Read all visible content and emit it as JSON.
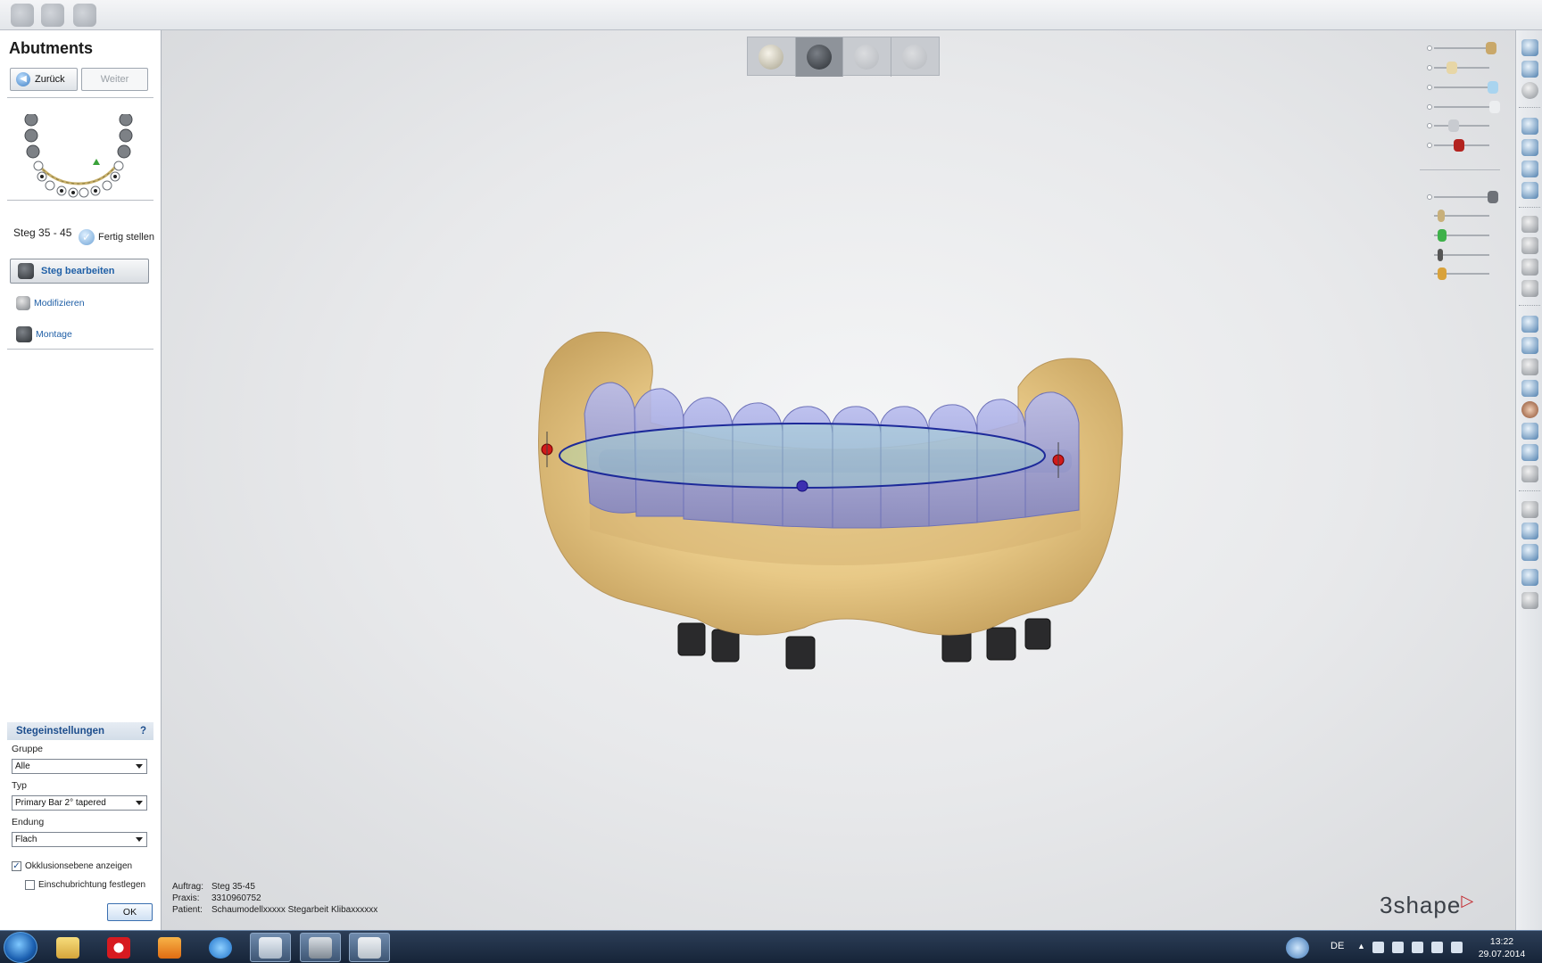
{
  "panel": {
    "title": "Abutments",
    "back_label": "Zurück",
    "next_label": "Weiter",
    "steg_label": "Steg 35 - 45",
    "finish_label": "Fertig stellen",
    "edit_label": "Steg bearbeiten",
    "modify_label": "Modifizieren",
    "mount_label": "Montage"
  },
  "settings": {
    "header": "Stegeinstellungen",
    "help": "?",
    "group_label": "Gruppe",
    "group_value": "Alle",
    "type_label": "Typ",
    "type_value": "Primary Bar 2° tapered",
    "ending_label": "Endung",
    "ending_value": "Flach",
    "occlusion_label": "Okklusionsebene anzeigen",
    "occlusion_checked": true,
    "insertion_label": "Einschubrichtung festlegen",
    "insertion_checked": false,
    "ok_label": "OK"
  },
  "info": {
    "order_key": "Auftrag:",
    "order_value": "Steg 35-45",
    "practice_key": "Praxis:",
    "practice_value": "3310960752",
    "patient_key": "Patient:",
    "patient_value": "Schaumodellxxxxx Stegarbeit Klibaxxxxxx"
  },
  "brand": {
    "logo": "3shape"
  },
  "taskbar": {
    "lang": "DE",
    "time": "13:22",
    "date": "29.07.2014"
  },
  "colors": {
    "accent_blue": "#1f5fa6",
    "model_gold": "#e9cf8c",
    "teeth_lavender": "#9a9fdc",
    "handle_red": "#d11a1a"
  }
}
